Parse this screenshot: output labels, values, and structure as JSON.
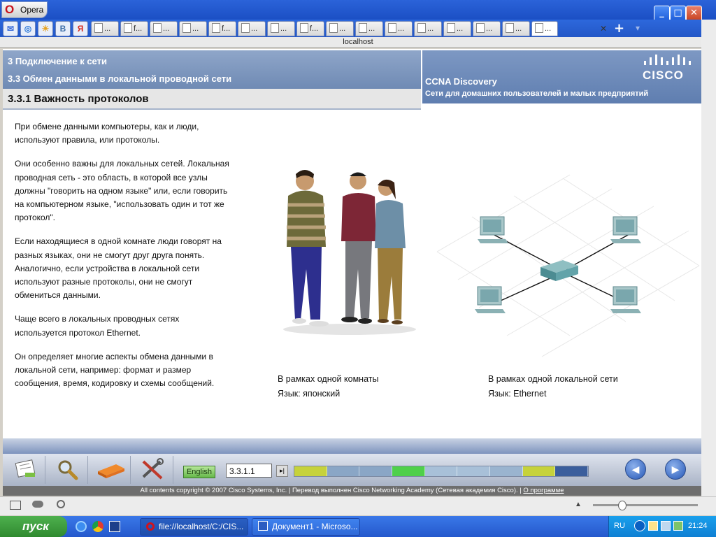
{
  "browser": {
    "menu_label": "Opera",
    "window_controls": {
      "minimize": "_",
      "maximize": "□",
      "close": "✕"
    },
    "tabs": [
      {
        "label": "...",
        "icon": "page-icon"
      },
      {
        "label": "f...",
        "icon": "page-icon"
      },
      {
        "label": "...",
        "icon": "download-icon"
      },
      {
        "label": "...",
        "icon": "page-icon"
      },
      {
        "label": "f...",
        "icon": "page-icon"
      },
      {
        "label": "...",
        "icon": "page-icon"
      },
      {
        "label": "...",
        "icon": "page-icon"
      },
      {
        "label": "f...",
        "icon": "page-icon"
      },
      {
        "label": "...",
        "icon": "page-icon"
      },
      {
        "label": "...",
        "icon": "page-icon"
      },
      {
        "label": "...",
        "icon": "page-icon"
      },
      {
        "label": "...",
        "icon": "search-icon"
      },
      {
        "label": "...",
        "icon": "video-icon"
      },
      {
        "label": "...",
        "icon": "search-icon"
      },
      {
        "label": "...",
        "icon": "y-icon"
      },
      {
        "label": "...",
        "icon": "page-icon"
      }
    ],
    "speed_dial": [
      "mail-icon",
      "globe-icon",
      "weather-icon",
      "vk-icon",
      "yandex-icon"
    ],
    "speed_dial_labels": [
      "✉",
      "◎",
      "☀",
      "В",
      "Я"
    ],
    "new_tab": "+",
    "tab_menu": "▾",
    "url": "localhost"
  },
  "course": {
    "chapter": "3 Подключение к сети",
    "section": "3.3 Обмен данными в локальной проводной сети",
    "subsection": "3.3.1 Важность протоколов",
    "product": "CCNA Discovery",
    "product_subtitle": "Сети для домашних пользователей и малых предприятий",
    "logo_text": "CISCO"
  },
  "content": {
    "paragraphs": [
      "При обмене данными компьютеры, как и люди, используют правила, или протоколы.",
      "Они особенно важны для локальных сетей. Локальная проводная сеть - это область, в которой все узлы должны \"говорить на одном языке\" или, если говорить на компьютерном языке, \"использовать один и тот же протокол\".",
      "Если находящиеся в одной комнате люди говорят на разных языках, они не смогут друг друга понять. Аналогично, если устройства в локальной сети используют разные протоколы, они не смогут обмениться данными.",
      "Чаще всего в локальных проводных сетях используется протокол Ethernet.",
      "Он определяет многие аспекты обмена данными в локальной сети, например: формат и размер сообщения, время, кодировку и схемы сообщений."
    ],
    "caption_left_title": "В рамках одной комнаты",
    "caption_left_lang": "Язык: японский",
    "caption_right_title": "В рамках одной локальной сети",
    "caption_right_lang": "Язык: Ethernet"
  },
  "navigation": {
    "tools": [
      "glossary-icon",
      "search-icon",
      "book-icon",
      "tools-icon"
    ],
    "language_button": "English",
    "page_number": "3.3.1.1",
    "go": "▸|",
    "prev": "◀",
    "next": "▶",
    "progress_colors": [
      "#c6d23b",
      "#8aa6c6",
      "#8aa6c6",
      "#4fd04a",
      "#a8c0d8",
      "#a8c0d8",
      "#9ab4cf",
      "#c6d23b",
      "#3b5e9c"
    ],
    "progress_completed_fraction": 0.63
  },
  "footer": {
    "copyright": "All contents copyright © 2007 Cisco Systems, Inc. | Перевод выполнен Cisco Networking Academy (Сетевая академия Cisco). |",
    "about_link": "О программе"
  },
  "taskbar": {
    "start": "пуск",
    "tasks": [
      "file://localhost/C:/CIS...",
      "Документ1 - Microso..."
    ],
    "lang": "RU",
    "time": "21:24"
  }
}
